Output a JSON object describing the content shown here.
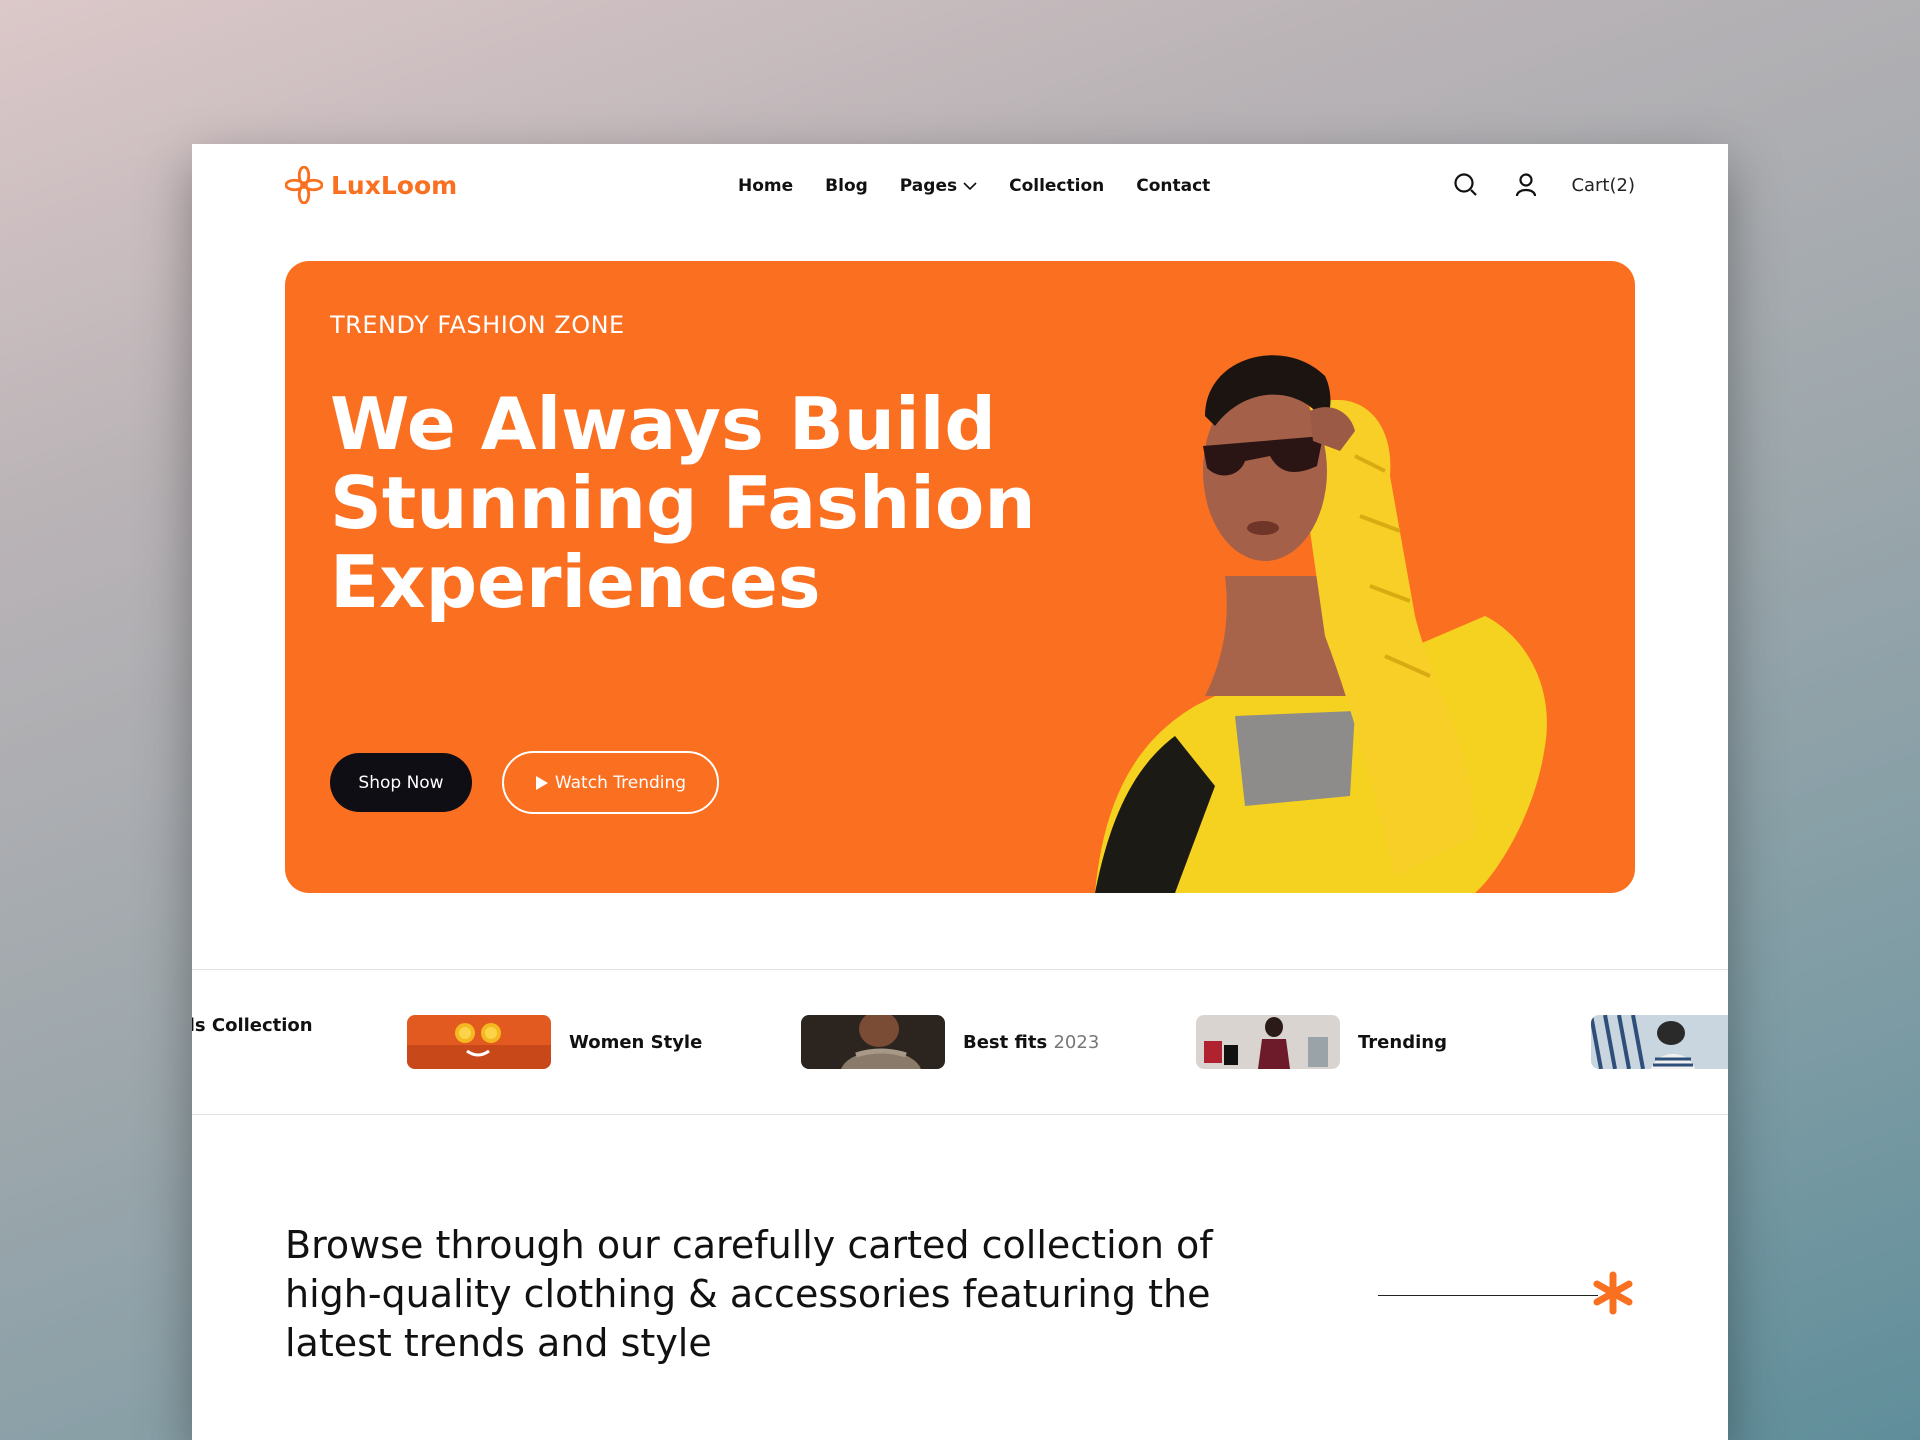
{
  "brand": {
    "name": "LuxLoom",
    "accent": "#f97021",
    "logo_icon": "flower-icon"
  },
  "nav": {
    "links": [
      "Home",
      "Blog",
      "Pages",
      "Collection",
      "Contact"
    ],
    "cart_label": "Cart(2)"
  },
  "hero": {
    "eyebrow": "TRENDY FASHION ZONE",
    "headline": "We Always Build Stunning Fashion Experiences",
    "shop_label": "Shop Now",
    "watch_label": "Watch Trending",
    "bg": "#fa6f20"
  },
  "strip": {
    "items": [
      {
        "label": "ds Collection"
      },
      {
        "label": "Women Style"
      },
      {
        "label": "Best fits",
        "year": "2023"
      },
      {
        "label": "Trending"
      },
      {
        "label": ""
      }
    ]
  },
  "browse": {
    "text": "Browse through our carefully carted collection of high-quality clothing & accessories featuring the latest trends and style"
  }
}
